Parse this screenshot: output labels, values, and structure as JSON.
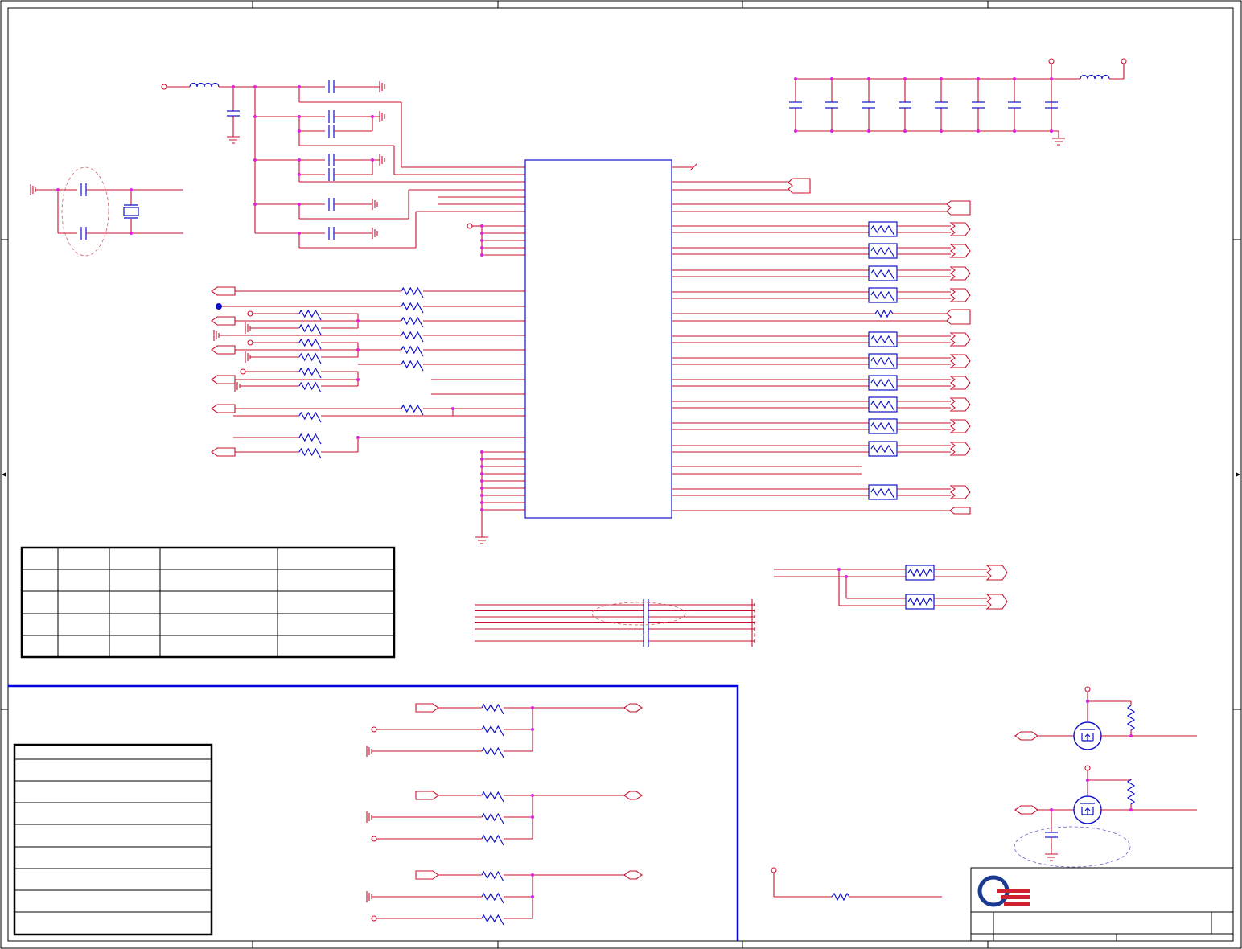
{
  "sheet": {
    "border_zone_marks": [
      "arrow-left",
      "arrow-right"
    ],
    "colors": {
      "wire": "#c8102e",
      "component": "#1010c8",
      "junction": "#e020e0",
      "frame": "#000000",
      "highlight_box": "#0000e0"
    }
  },
  "crystal_block": {
    "components": [
      "capacitor",
      "capacitor",
      "crystal"
    ]
  },
  "power_filter_left": {
    "components": [
      "inductor",
      "capacitor",
      "capacitor",
      "capacitor",
      "capacitor",
      "capacitor",
      "capacitor",
      "capacitor",
      "capacitor"
    ]
  },
  "power_filter_right": {
    "components": [
      "inductor",
      "capacitor",
      "capacitor",
      "capacitor",
      "capacitor",
      "capacitor",
      "capacitor",
      "capacitor",
      "capacitor"
    ]
  },
  "main_ic": {
    "left_pin_count": 30,
    "right_pin_count": 30
  },
  "right_side_filters": {
    "count": 12
  },
  "strap_table": {
    "rows": 5,
    "columns": 5
  },
  "revision_table": {
    "rows": 9
  },
  "mosfet_level_shifters": {
    "count": 2
  },
  "title_block": {
    "logo": "company-logo-icon"
  }
}
